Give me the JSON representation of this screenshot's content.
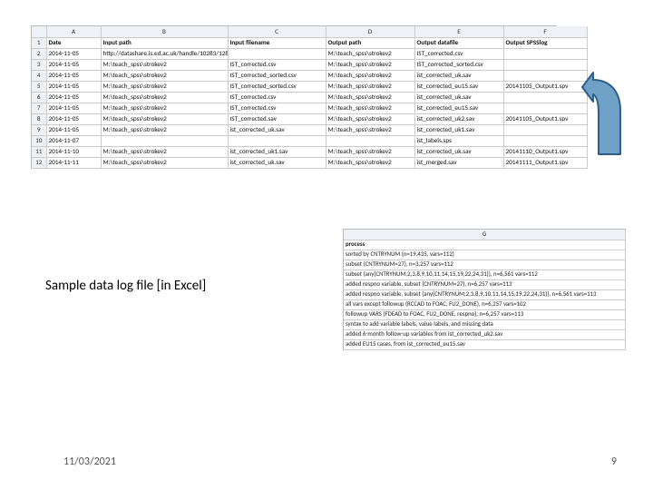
{
  "sheet1": {
    "col_letters": [
      "A",
      "B",
      "C",
      "D",
      "E",
      "F"
    ],
    "headers": [
      "Date",
      "Input path",
      "Input filename",
      "Output path",
      "Output datafile",
      "Output SPSSlog"
    ],
    "rows": [
      [
        "2014-11-05",
        "http://datashare.is.ed.ac.uk/handle/10283/128",
        "",
        "M:\\teach_spss\\strokev2",
        "IST_corrected.csv",
        ""
      ],
      [
        "2014-11-05",
        "M:\\teach_spss\\strokev2",
        "IST_corrected.csv",
        "M:\\teach_spss\\strokev2",
        "IST_corrected_sorted.csv",
        ""
      ],
      [
        "2014-11-05",
        "M:\\teach_spss\\strokev2",
        "IST_corrected_sorted.csv",
        "M:\\teach_spss\\strokev2",
        "ist_corrected_uk.sav",
        ""
      ],
      [
        "2014-11-05",
        "M:\\teach_spss\\strokev2",
        "IST_corrected_sorted.csv",
        "M:\\teach_spss\\strokev2",
        "ist_corrected_eu15.sav",
        "20141105_Output1.spv"
      ],
      [
        "2014-11-05",
        "M:\\teach_spss\\strokev2",
        "IST_corrected.csv",
        "M:\\teach_spss\\strokev2",
        "ist_corrected_uk.sav",
        ""
      ],
      [
        "2014-11-05",
        "M:\\teach_spss\\strokev2",
        "IST_corrected.csv",
        "M:\\teach_spss\\strokev2",
        "ist_corrected_eu15.sav",
        ""
      ],
      [
        "2014-11-05",
        "M:\\teach_spss\\strokev2",
        "IST_corrected.sav",
        "M:\\teach_spss\\strokev2",
        "ist_corrected_uk2.sav",
        "20141105_Output1.spv"
      ],
      [
        "2014-11-05",
        "M:\\teach_spss\\strokev2",
        "ist_corrected_uk.sav",
        "M:\\teach_spss\\strokev2",
        "ist_corrected_uk1.sav",
        ""
      ],
      [
        "2014-11-07",
        "",
        "",
        "",
        "ist_labels.sps",
        ""
      ],
      [
        "2014-11-10",
        "M:\\teach_spss\\strokev2",
        "ist_corrected_uk1.sav",
        "M:\\teach_spss\\strokev2",
        "ist_corrected_uk.sav",
        "20141110_Output1.spv"
      ],
      [
        "2014-11-11",
        "M:\\teach_spss\\strokev2",
        "ist_corrected_uk.sav",
        "M:\\teach_spss\\strokev2",
        "ist_merged.sav",
        "20141111_Output1.spv"
      ]
    ],
    "red_cells": [
      [
        4,
        5
      ],
      [
        7,
        5
      ],
      [
        10,
        5
      ],
      [
        11,
        5
      ]
    ]
  },
  "sheet2": {
    "col_header": "G",
    "subhead": "process",
    "lines": [
      "sorted by CNTRYNUM (n=19,435, vars=112)",
      "subset (CNTRYNUM=27), n=3,257 vars=112",
      "subset (any(CNTRYNUM;2,3,8,9,10,11,14,15,19,22,24,31)), n=6,561 vars=112",
      "added respno variable, subset (CNTRYNUM=27), n=6,257 vars=113",
      "added respno variable, subset (any(CNTRYNUM;2,3,8,9,10,11,14,15,19,22,24,31)), n=6,561 vars=113",
      "all vars except followup (RCCAD to FOAC, FU2_DONE), n=6,257 vars=102",
      "followup VARS (FDEAD to FOAC, FU2_DONE, respno), n=6,257 vars=113",
      "syntax to add variable labels, value labels, and missing data",
      "added 6-month follow-up variables from ist_corrected_uk2.sav",
      "added EU15 cases, from ist_corrected_eu15.sav"
    ]
  },
  "caption": "Sample data log file [in Excel]",
  "footer": {
    "date": "11/03/2021",
    "page": "9"
  },
  "colors": {
    "arrow_fill": "#6fa0c6",
    "arrow_stroke": "#2f5e86"
  }
}
